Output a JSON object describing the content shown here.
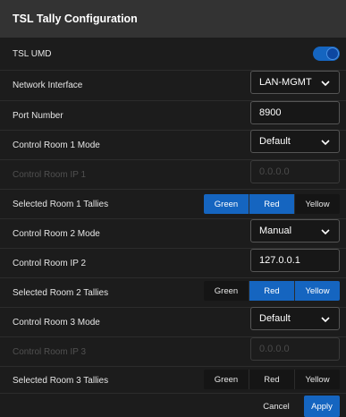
{
  "dialog": {
    "title": "TSL Tally Configuration"
  },
  "colors": {
    "accent": "#1565c0",
    "background": "#1c1c1c",
    "titlebar": "#333333"
  },
  "rows": {
    "tsl_umd": {
      "label": "TSL UMD",
      "enabled": true
    },
    "network_interface": {
      "label": "Network Interface",
      "value": "LAN-MGMT"
    },
    "port_number": {
      "label": "Port Number",
      "value": "8900"
    },
    "cr1_mode": {
      "label": "Control Room 1 Mode",
      "value": "Default"
    },
    "cr1_ip": {
      "label": "Control Room IP 1",
      "placeholder": "0.0.0.0",
      "disabled": true
    },
    "room1_tallies": {
      "label": "Selected Room 1 Tallies",
      "options": [
        "Green",
        "Red",
        "Yellow"
      ],
      "selected": [
        "Green",
        "Red"
      ]
    },
    "cr2_mode": {
      "label": "Control Room 2  Mode",
      "value": "Manual"
    },
    "cr2_ip": {
      "label": "Control Room IP 2",
      "value": "127.0.0.1"
    },
    "room2_tallies": {
      "label": "Selected Room 2 Tallies",
      "options": [
        "Green",
        "Red",
        "Yellow"
      ],
      "selected": [
        "Red",
        "Yellow"
      ]
    },
    "cr3_mode": {
      "label": "Control Room 3  Mode",
      "value": "Default"
    },
    "cr3_ip": {
      "label": "Control Room IP 3",
      "placeholder": "0.0.0.0",
      "disabled": true
    },
    "room3_tallies": {
      "label": "Selected Room 3 Tallies",
      "options": [
        "Green",
        "Red",
        "Yellow"
      ],
      "selected": []
    }
  },
  "footer": {
    "cancel_label": "Cancel",
    "apply_label": "Apply"
  }
}
